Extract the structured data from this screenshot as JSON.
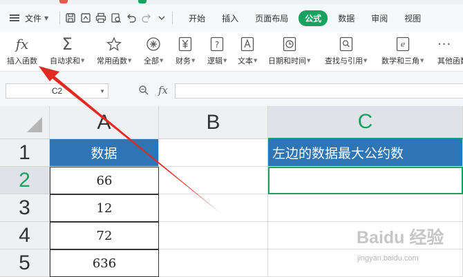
{
  "menubar": {
    "file_label": "文件",
    "tabs": [
      {
        "label": "开始",
        "active": false
      },
      {
        "label": "插入",
        "active": false
      },
      {
        "label": "页面布局",
        "active": false
      },
      {
        "label": "公式",
        "active": true
      },
      {
        "label": "数据",
        "active": false
      },
      {
        "label": "审阅",
        "active": false
      },
      {
        "label": "视图",
        "active": false
      }
    ],
    "quick_access_icons": [
      "save-icon",
      "export-icon",
      "print-icon",
      "print-preview-icon",
      "undo-icon",
      "redo-icon",
      "customize-icon"
    ]
  },
  "ribbon": {
    "items": [
      {
        "label": "插入函数",
        "icon": "fx-icon"
      },
      {
        "label": "自动求和",
        "icon": "sigma-icon"
      },
      {
        "label": "常用函数",
        "icon": "star-icon"
      },
      {
        "label": "全部",
        "icon": "all-functions-icon"
      },
      {
        "label": "财务",
        "icon": "yen-icon"
      },
      {
        "label": "逻辑",
        "icon": "question-icon"
      },
      {
        "label": "文本",
        "icon": "text-icon"
      },
      {
        "label": "日期和时间",
        "icon": "clock-icon"
      },
      {
        "label": "查找与引用",
        "icon": "search-doc-icon"
      },
      {
        "label": "数学和三角",
        "icon": "math-icon"
      },
      {
        "label": "其他函数",
        "icon": "more-icon"
      }
    ]
  },
  "formula_bar": {
    "cell_ref": "C2",
    "fx_label": "fx",
    "formula": ""
  },
  "sheet": {
    "columns": [
      "A",
      "B",
      "C"
    ],
    "selected_column": "C",
    "rows": [
      "1",
      "2",
      "3",
      "4",
      "5"
    ],
    "selected_row": "2",
    "cells": {
      "A1": "数据",
      "A2": "66",
      "A3": "12",
      "A4": "72",
      "A5": "636",
      "C1": "左边的数据最大公约数"
    },
    "active_cell": "C2"
  },
  "watermark": {
    "brand": "Baidu 经验",
    "url": "jingyan.baidu.com"
  },
  "colors": {
    "accent_green": "#19a15f",
    "header_blue": "#2e75b6",
    "arrow_red": "#e02a22"
  }
}
